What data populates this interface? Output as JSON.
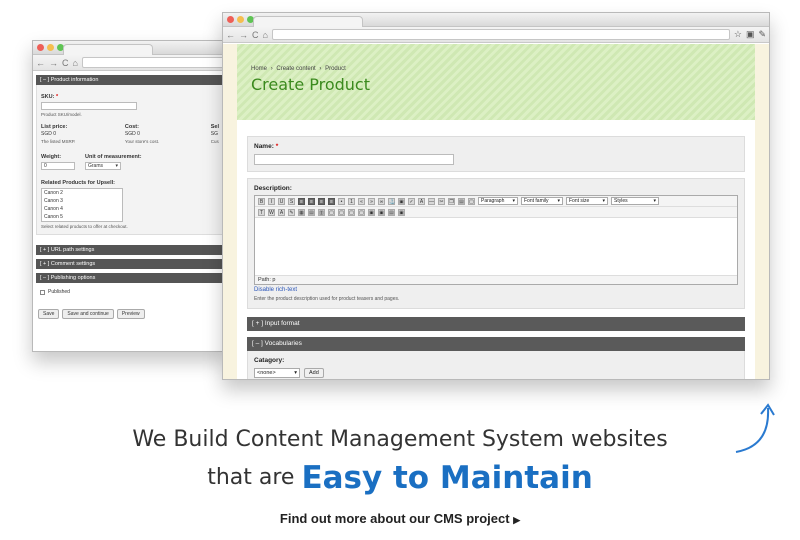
{
  "back_window": {
    "product_info_header": "[ – ] Product information",
    "sku_label": "SKU:",
    "sku_required": "*",
    "sku_desc": "Product SKU/model.",
    "list_price_label": "List price:",
    "list_price_currency": "SGD",
    "list_price_value": "0",
    "list_price_desc": "The listed MSRP.",
    "cost_label": "Cost:",
    "cost_currency": "SGD",
    "cost_value": "0",
    "cost_desc": "Your store's cost.",
    "sell_label": "Sel",
    "sell_currency": "SG",
    "sell_desc": "Cus",
    "weight_label": "Weight:",
    "weight_value": "0",
    "unit_label": "Unit of measurement:",
    "unit_value": "Grams",
    "related_label": "Related Products for Upsell:",
    "related_items": [
      "Canon 2",
      "Canon 3",
      "Canon 4",
      "Canon 5"
    ],
    "related_desc": "Select related products to offer at checkout.",
    "url_settings": "[ + ] URL path settings",
    "comment_settings": "[ + ] Comment settings",
    "publishing_options": "[ – ] Publishing options",
    "published_label": "Published",
    "buttons": [
      "Save",
      "Save and continue",
      "Preview"
    ]
  },
  "front_window": {
    "breadcrumb": [
      "Home",
      "›",
      "Create content",
      "›",
      "Product"
    ],
    "page_title": "Create Product",
    "name_label": "Name:",
    "name_required": "*",
    "description_label": "Description:",
    "editor_selects": {
      "format": "Paragraph",
      "font_family": "Font family",
      "font_size": "Font size",
      "styles": "Styles"
    },
    "editor_path": "Path: p",
    "disable_rich_text": "Disable rich-text",
    "description_help": "Enter the product description used for product teasers and pages.",
    "input_format": "[ + ] Input format",
    "vocabularies": "[ – ] Vocabularies",
    "category_label": "Catagory:",
    "category_value": "<none>",
    "add_button": "Add"
  },
  "marketing": {
    "line1": "We Build Content Management System websites",
    "line2_prefix": "that are",
    "line2_emphasis": "Easy to Maintain",
    "cta": "Find out more about our CMS project"
  },
  "colors": {
    "accent_blue": "#1a6fc2",
    "title_green": "#3b8a1e"
  }
}
